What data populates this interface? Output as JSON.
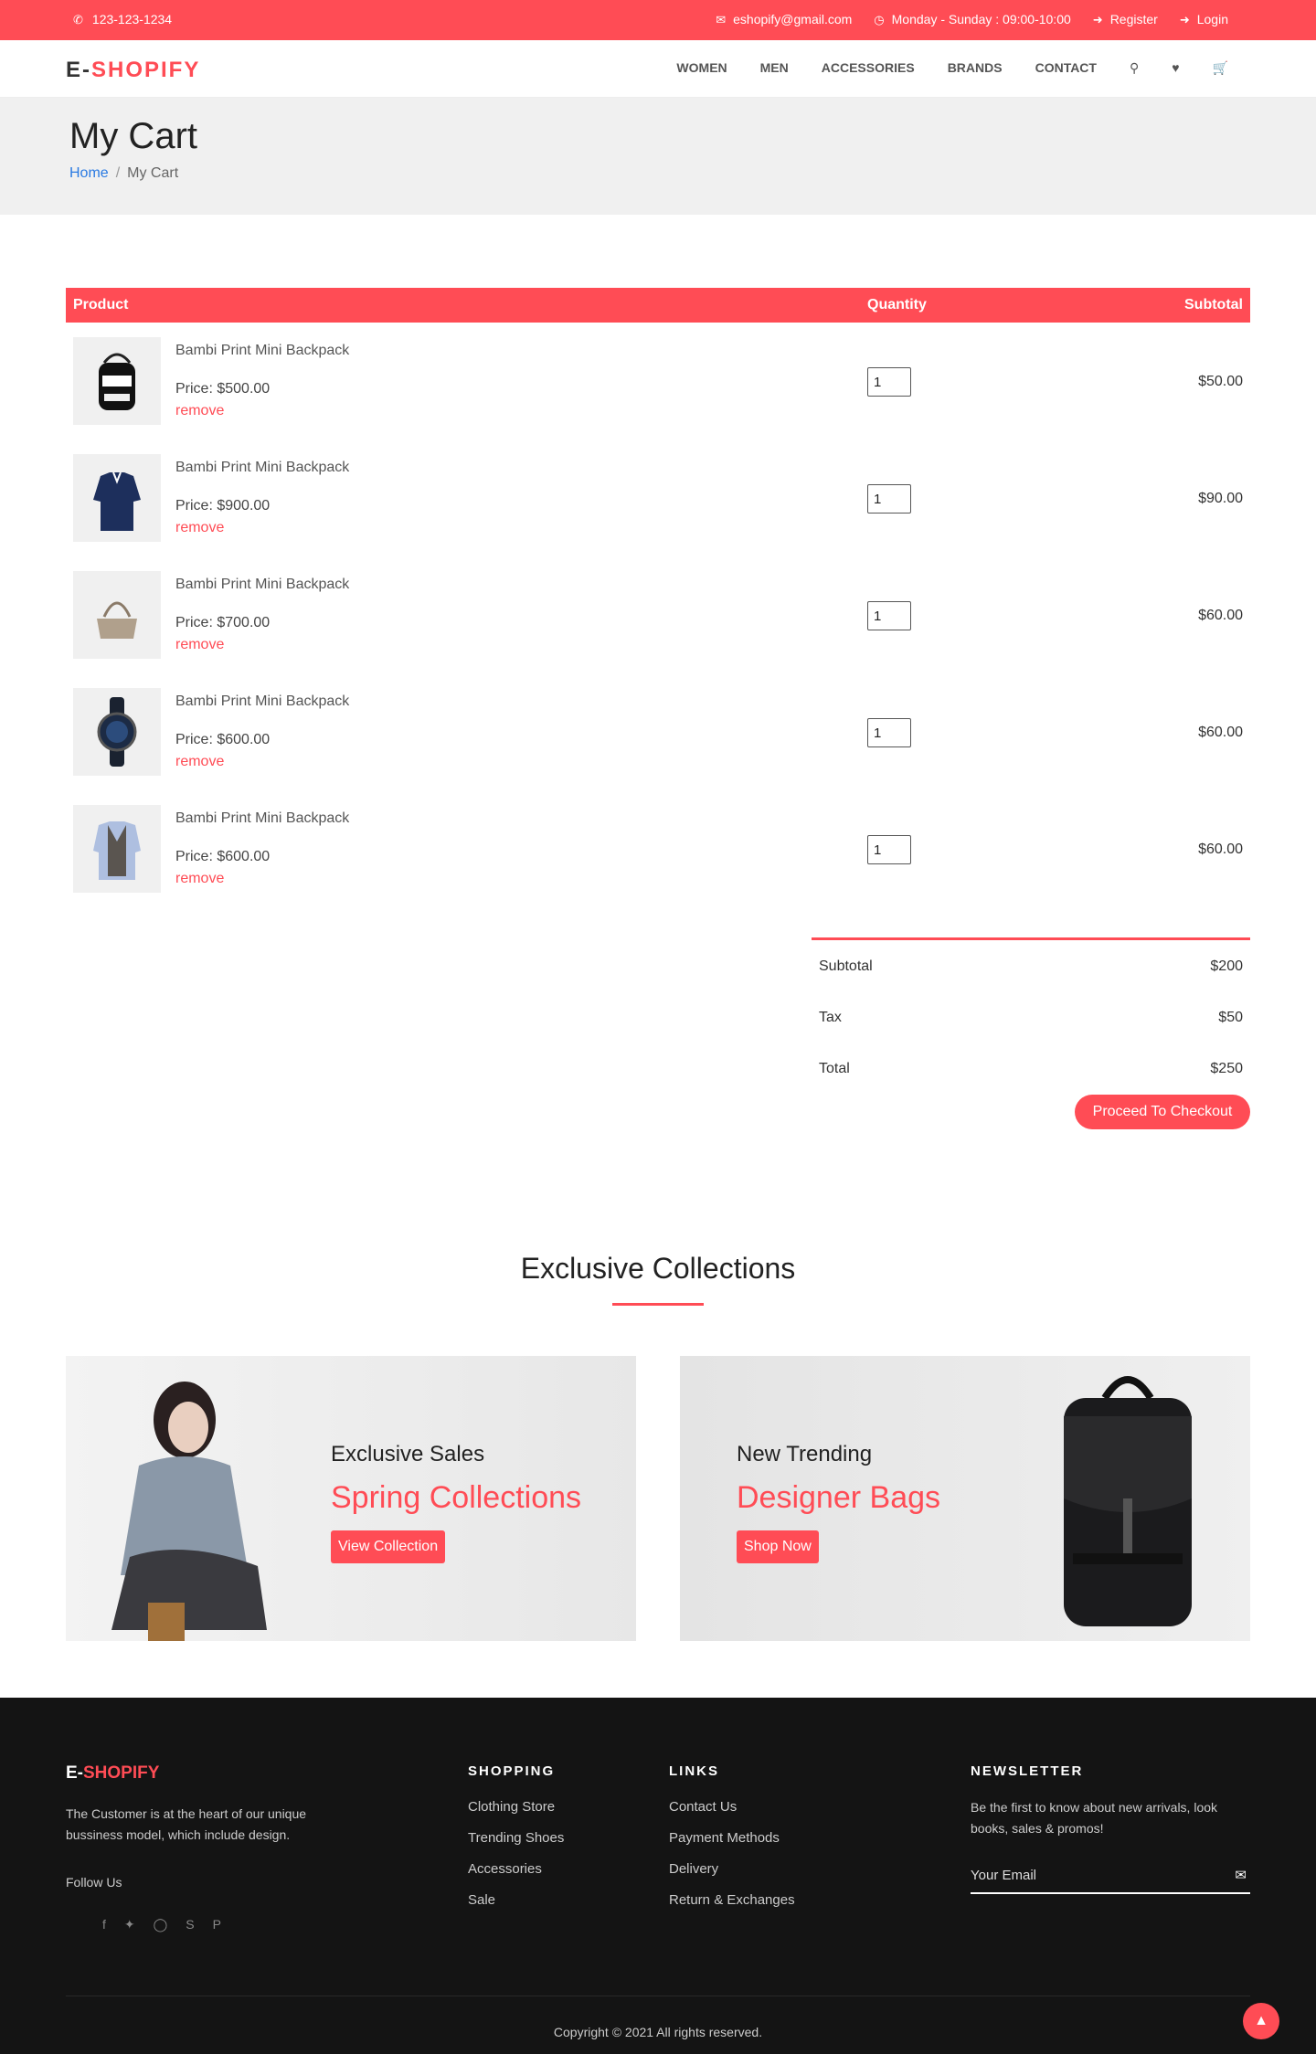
{
  "topbar": {
    "phone": "123-123-1234",
    "email": "eshopify@gmail.com",
    "hours": "Monday - Sunday : 09:00-10:00",
    "register": "Register",
    "login": "Login"
  },
  "brand": {
    "prefix": "E-",
    "name": "SHOPIFY"
  },
  "nav": {
    "women": "WOMEN",
    "men": "MEN",
    "accessories": "ACCESSORIES",
    "brands": "BRANDS",
    "contact": "CONTACT"
  },
  "page": {
    "title": "My Cart",
    "breadcrumb_home": "Home",
    "breadcrumb_sep": "/",
    "breadcrumb_current": "My Cart"
  },
  "cart": {
    "headers": {
      "product": "Product",
      "quantity": "Quantity",
      "subtotal": "Subtotal"
    },
    "items": [
      {
        "name": "Bambi Print Mini Backpack",
        "price": "Price: $500.00",
        "remove": "remove",
        "qty": "1",
        "subtotal": "$50.00",
        "image": "backpack-image"
      },
      {
        "name": "Bambi Print Mini Backpack",
        "price": "Price: $900.00",
        "remove": "remove",
        "qty": "1",
        "subtotal": "$90.00",
        "image": "shirt-image"
      },
      {
        "name": "Bambi Print Mini Backpack",
        "price": "Price: $700.00",
        "remove": "remove",
        "qty": "1",
        "subtotal": "$60.00",
        "image": "handbag-image"
      },
      {
        "name": "Bambi Print Mini Backpack",
        "price": "Price: $600.00",
        "remove": "remove",
        "qty": "1",
        "subtotal": "$60.00",
        "image": "watch-image"
      },
      {
        "name": "Bambi Print Mini Backpack",
        "price": "Price: $600.00",
        "remove": "remove",
        "qty": "1",
        "subtotal": "$60.00",
        "image": "vest-image"
      }
    ],
    "totals": {
      "subtotal_label": "Subtotal",
      "subtotal": "$200",
      "tax_label": "Tax",
      "tax": "$50",
      "total_label": "Total",
      "total": "$250"
    },
    "checkout": "Proceed To Checkout"
  },
  "collections": {
    "title": "Exclusive Collections",
    "banner1": {
      "kicker": "Exclusive Sales",
      "title": "Spring Collections",
      "button": "View Collection"
    },
    "banner2": {
      "kicker": "New Trending",
      "title": "Designer Bags",
      "button": "Shop Now"
    }
  },
  "footer": {
    "brand_prefix": "E-",
    "brand_name": "SHOPIFY",
    "description": "The Customer is at the heart of our unique bussiness model, which include design.",
    "follow": "Follow Us",
    "social_icons": [
      "facebook-icon",
      "twitter-icon",
      "instagram-icon",
      "skype-icon",
      "pinterest-icon"
    ],
    "shopping": {
      "title": "SHOPPING",
      "links": [
        "Clothing Store",
        "Trending Shoes",
        "Accessories",
        "Sale"
      ]
    },
    "links": {
      "title": "LINKS",
      "links": [
        "Contact Us",
        "Payment Methods",
        "Delivery",
        "Return & Exchanges"
      ]
    },
    "newsletter": {
      "title": "NEWSLETTER",
      "text": "Be the first to know about new arrivals, look books, sales & promos!",
      "placeholder": "Your Email"
    },
    "copyright": "Copyright © 2021 All rights reserved."
  },
  "colors": {
    "accent": "#ff4c55",
    "footer_bg": "#141414",
    "header_band": "#f0f0f0"
  }
}
